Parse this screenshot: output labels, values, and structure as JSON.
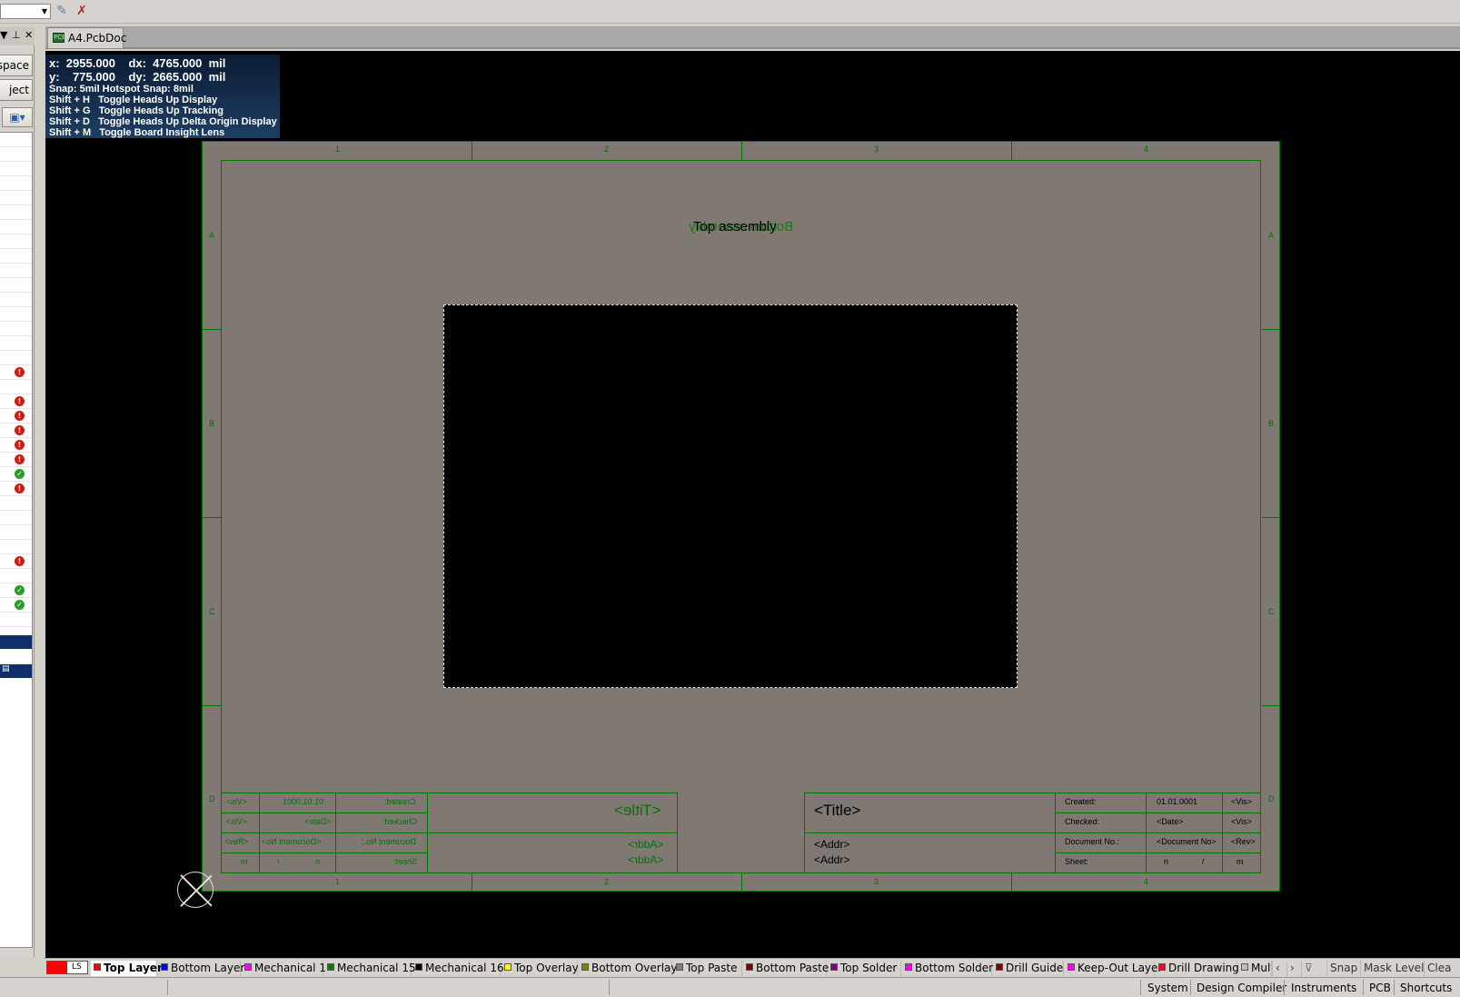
{
  "toolbar": {
    "icons": [
      "probe-icon",
      "probe-clear-icon"
    ]
  },
  "left_panel": {
    "buttons": [
      "space",
      "ject"
    ],
    "status_rows": [
      {
        "status": "error"
      },
      {
        "status": "error"
      },
      {
        "status": "error"
      },
      {
        "status": "error"
      },
      {
        "status": "error"
      },
      {
        "status": "error"
      },
      {
        "status": "ok"
      },
      {
        "status": "error"
      },
      {
        "status": "error"
      },
      {
        "status": "ok"
      },
      {
        "status": "ok"
      }
    ]
  },
  "document": {
    "tab_label": "A4.PcbDoc",
    "tab_icon_text": "PCB"
  },
  "hud": {
    "line1": "x:  2955.000    dx:  4765.000  mil",
    "line2": "y:    775.000    dy:  2665.000  mil",
    "snap": "Snap: 5mil Hotspot Snap: 8mil",
    "shortcuts": [
      "Shift + H   Toggle Heads Up Display",
      "Shift + G   Toggle Heads Up Tracking",
      "Shift + D   Toggle Heads Up Delta Origin Display",
      "Shift + M   Toggle Board Insight Lens"
    ]
  },
  "sheet": {
    "column_labels": [
      "1",
      "2",
      "3",
      "4"
    ],
    "row_labels": [
      "A",
      "B",
      "C",
      "D"
    ],
    "top_assembly": "Top assembly",
    "bottom_assembly": "Bottom assembly",
    "title_block": {
      "title": "<Title>",
      "addr1": "<Addr>",
      "addr2": "<Addr>",
      "created_label": "Created:",
      "created_value": "01.01.0001",
      "checked_label": "Checked:",
      "checked_value": "<Date>",
      "docno_label": "Document No.:",
      "docno_value": "<Document No>",
      "sheet_label": "Sheet:",
      "sheet_n": "n",
      "sheet_slash": "/",
      "sheet_m": "m",
      "vis1": "<Vis>",
      "vis2": "<Vis>",
      "rev": "<Rev>"
    },
    "mirror_block": {
      "title": "<Title>",
      "addr1": "<Addr>",
      "addr2": "<Addr>",
      "created_label": "Created:",
      "created_value": "01.01.0001",
      "checked_label": "Checked:",
      "checked_value": "<Date>",
      "docno_label": "Document No.:",
      "docno_value": "<Document No>",
      "sheet_label": "Sheet:",
      "sheet_n": "n",
      "sheet_slash": "/",
      "sheet_m": "m",
      "vis1": "<Vis>",
      "vis2": "<Vis>",
      "rev": "<Rev>"
    }
  },
  "layers": {
    "ls_label": "LS",
    "tabs": [
      {
        "label": "Top Layer",
        "color": "#ff0000",
        "active": true
      },
      {
        "label": "Bottom Layer",
        "color": "#0000ff"
      },
      {
        "label": "Mechanical 1",
        "color": "#ff00ff"
      },
      {
        "label": "Mechanical 15",
        "color": "#008000"
      },
      {
        "label": "Mechanical 16",
        "color": "#000000"
      },
      {
        "label": "Top Overlay",
        "color": "#ffff00"
      },
      {
        "label": "Bottom Overlay",
        "color": "#808000"
      },
      {
        "label": "Top Paste",
        "color": "#808080"
      },
      {
        "label": "Bottom Paste",
        "color": "#800000"
      },
      {
        "label": "Top Solder",
        "color": "#800080"
      },
      {
        "label": "Bottom Solder",
        "color": "#ff00ff"
      },
      {
        "label": "Drill Guide",
        "color": "#800000"
      },
      {
        "label": "Keep-Out Layer",
        "color": "#ff00ff"
      },
      {
        "label": "Drill Drawing",
        "color": "#ff002a"
      },
      {
        "label": "Mult",
        "color": "#c0c0c0"
      }
    ],
    "right_tools": [
      "Snap",
      "Mask Level",
      "Clea"
    ]
  },
  "statusbar": {
    "buttons": [
      "System",
      "Design Compiler",
      "Instruments",
      "PCB",
      "Shortcuts"
    ]
  }
}
